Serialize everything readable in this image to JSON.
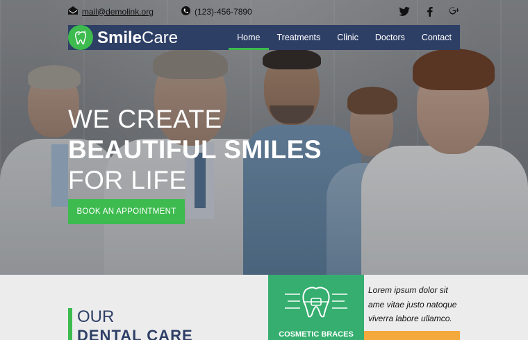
{
  "topbar": {
    "email": "mail@demolink.org",
    "phone": "(123)-456-7890",
    "social": [
      "twitter-icon",
      "facebook-icon",
      "google-plus-icon"
    ]
  },
  "nav": {
    "brand_bold": "Smile",
    "brand_light": "Care",
    "items": [
      "Home",
      "Treatments",
      "Clinic",
      "Doctors",
      "Contact"
    ],
    "active": "Home"
  },
  "hero": {
    "line1": "WE CREATE",
    "line2": "BEAUTIFUL SMILES",
    "line3": "FOR LIFE",
    "cta": "BOOK AN APPOINTMENT"
  },
  "section": {
    "title_line1": "OUR",
    "title_line2": "DENTAL CARE",
    "service_label": "COSMETIC BRACES",
    "description": "Lorem ipsum dolor sit ame vitae justo natoque viverra labore ullamco."
  },
  "colors": {
    "accent_green": "#3dbb4f",
    "nav_blue": "#2e3f66",
    "service_green": "#35ae6f",
    "orange": "#f4a93d"
  }
}
